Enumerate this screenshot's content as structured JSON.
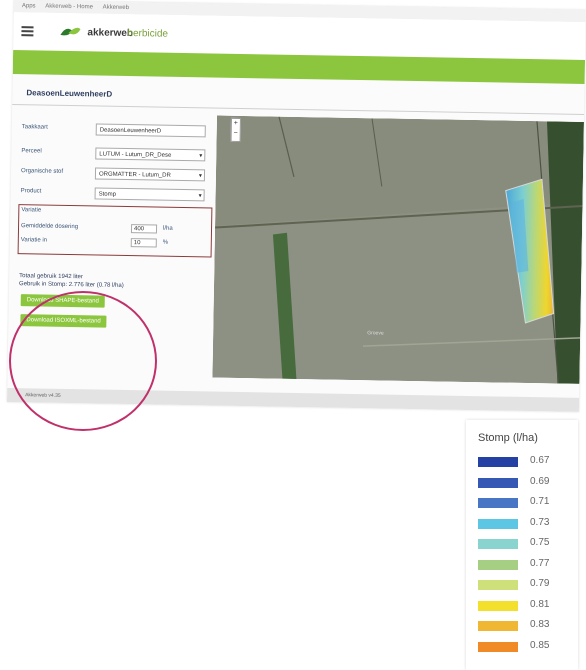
{
  "browser": {
    "bookmarks": [
      "Apps",
      "Akkerweb - Home",
      "Akkerweb"
    ]
  },
  "header": {
    "brand": "akkerweb",
    "module": "herbicide"
  },
  "page": {
    "title": "DeasoenLeuwenheerD"
  },
  "form": {
    "fields": [
      {
        "label": "Taakkaart",
        "value": "DeasoenLeuwenheerD"
      },
      {
        "label": "Perceel",
        "value": "LUTUM - Lutum_DR_Dese",
        "dropdown": true
      },
      {
        "label": "Organische stof",
        "value": "ORGMATTER - Lutum_DR",
        "dropdown": true
      },
      {
        "label": "Product",
        "value": "Stomp",
        "dropdown": true
      }
    ],
    "params": {
      "title": "Variatie",
      "rows": [
        {
          "label": "Gemiddelde dosering",
          "value": "400",
          "unit": "l/ha"
        },
        {
          "label": "Variatie in",
          "value": "10",
          "unit": "%"
        }
      ]
    }
  },
  "usage": {
    "line1": "Totaal gebruik 1942 liter",
    "line2": "Gebruik in Stomp: 2.776 liter (0.78 l/ha)"
  },
  "buttons": {
    "download_shape": "Download SHAPE-bestand",
    "download_isoxml": "Download ISOXML-bestand"
  },
  "map": {
    "zoom_plus": "+",
    "zoom_minus": "−",
    "road_label": "Groeve"
  },
  "footer": {
    "text": "Akkerweb v4.35"
  },
  "annotation": {
    "color": "#c0306a"
  },
  "legend": {
    "title": "Stomp (l/ha)",
    "items": [
      {
        "color": "#2541a3",
        "value": "0.67"
      },
      {
        "color": "#3658b5",
        "value": "0.69"
      },
      {
        "color": "#4876c4",
        "value": "0.71"
      },
      {
        "color": "#5cc6e4",
        "value": "0.73"
      },
      {
        "color": "#8ad4cf",
        "value": "0.75"
      },
      {
        "color": "#a6cf84",
        "value": "0.77"
      },
      {
        "color": "#cde07a",
        "value": "0.79"
      },
      {
        "color": "#f2e02c",
        "value": "0.81"
      },
      {
        "color": "#f0b735",
        "value": "0.83"
      },
      {
        "color": "#ef8a26",
        "value": "0.85"
      }
    ]
  }
}
